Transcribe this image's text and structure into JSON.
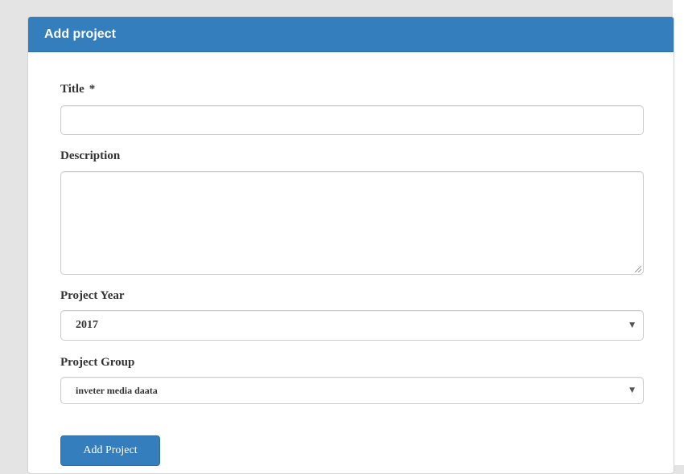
{
  "panel": {
    "title": "Add project"
  },
  "form": {
    "title_label": "Title",
    "required_marker": "*",
    "title_value": "",
    "description_label": "Description",
    "description_value": "",
    "year_label": "Project Year",
    "year_value": "2017",
    "group_label": "Project Group",
    "group_value": "inveter media daata",
    "submit_label": "Add Project"
  },
  "icons": {
    "select_caret": "caret-down-icon",
    "textarea_resize": "resize-grip-icon"
  },
  "colors": {
    "primary": "#357ebd",
    "border": "#cccccc",
    "text": "#333333"
  }
}
